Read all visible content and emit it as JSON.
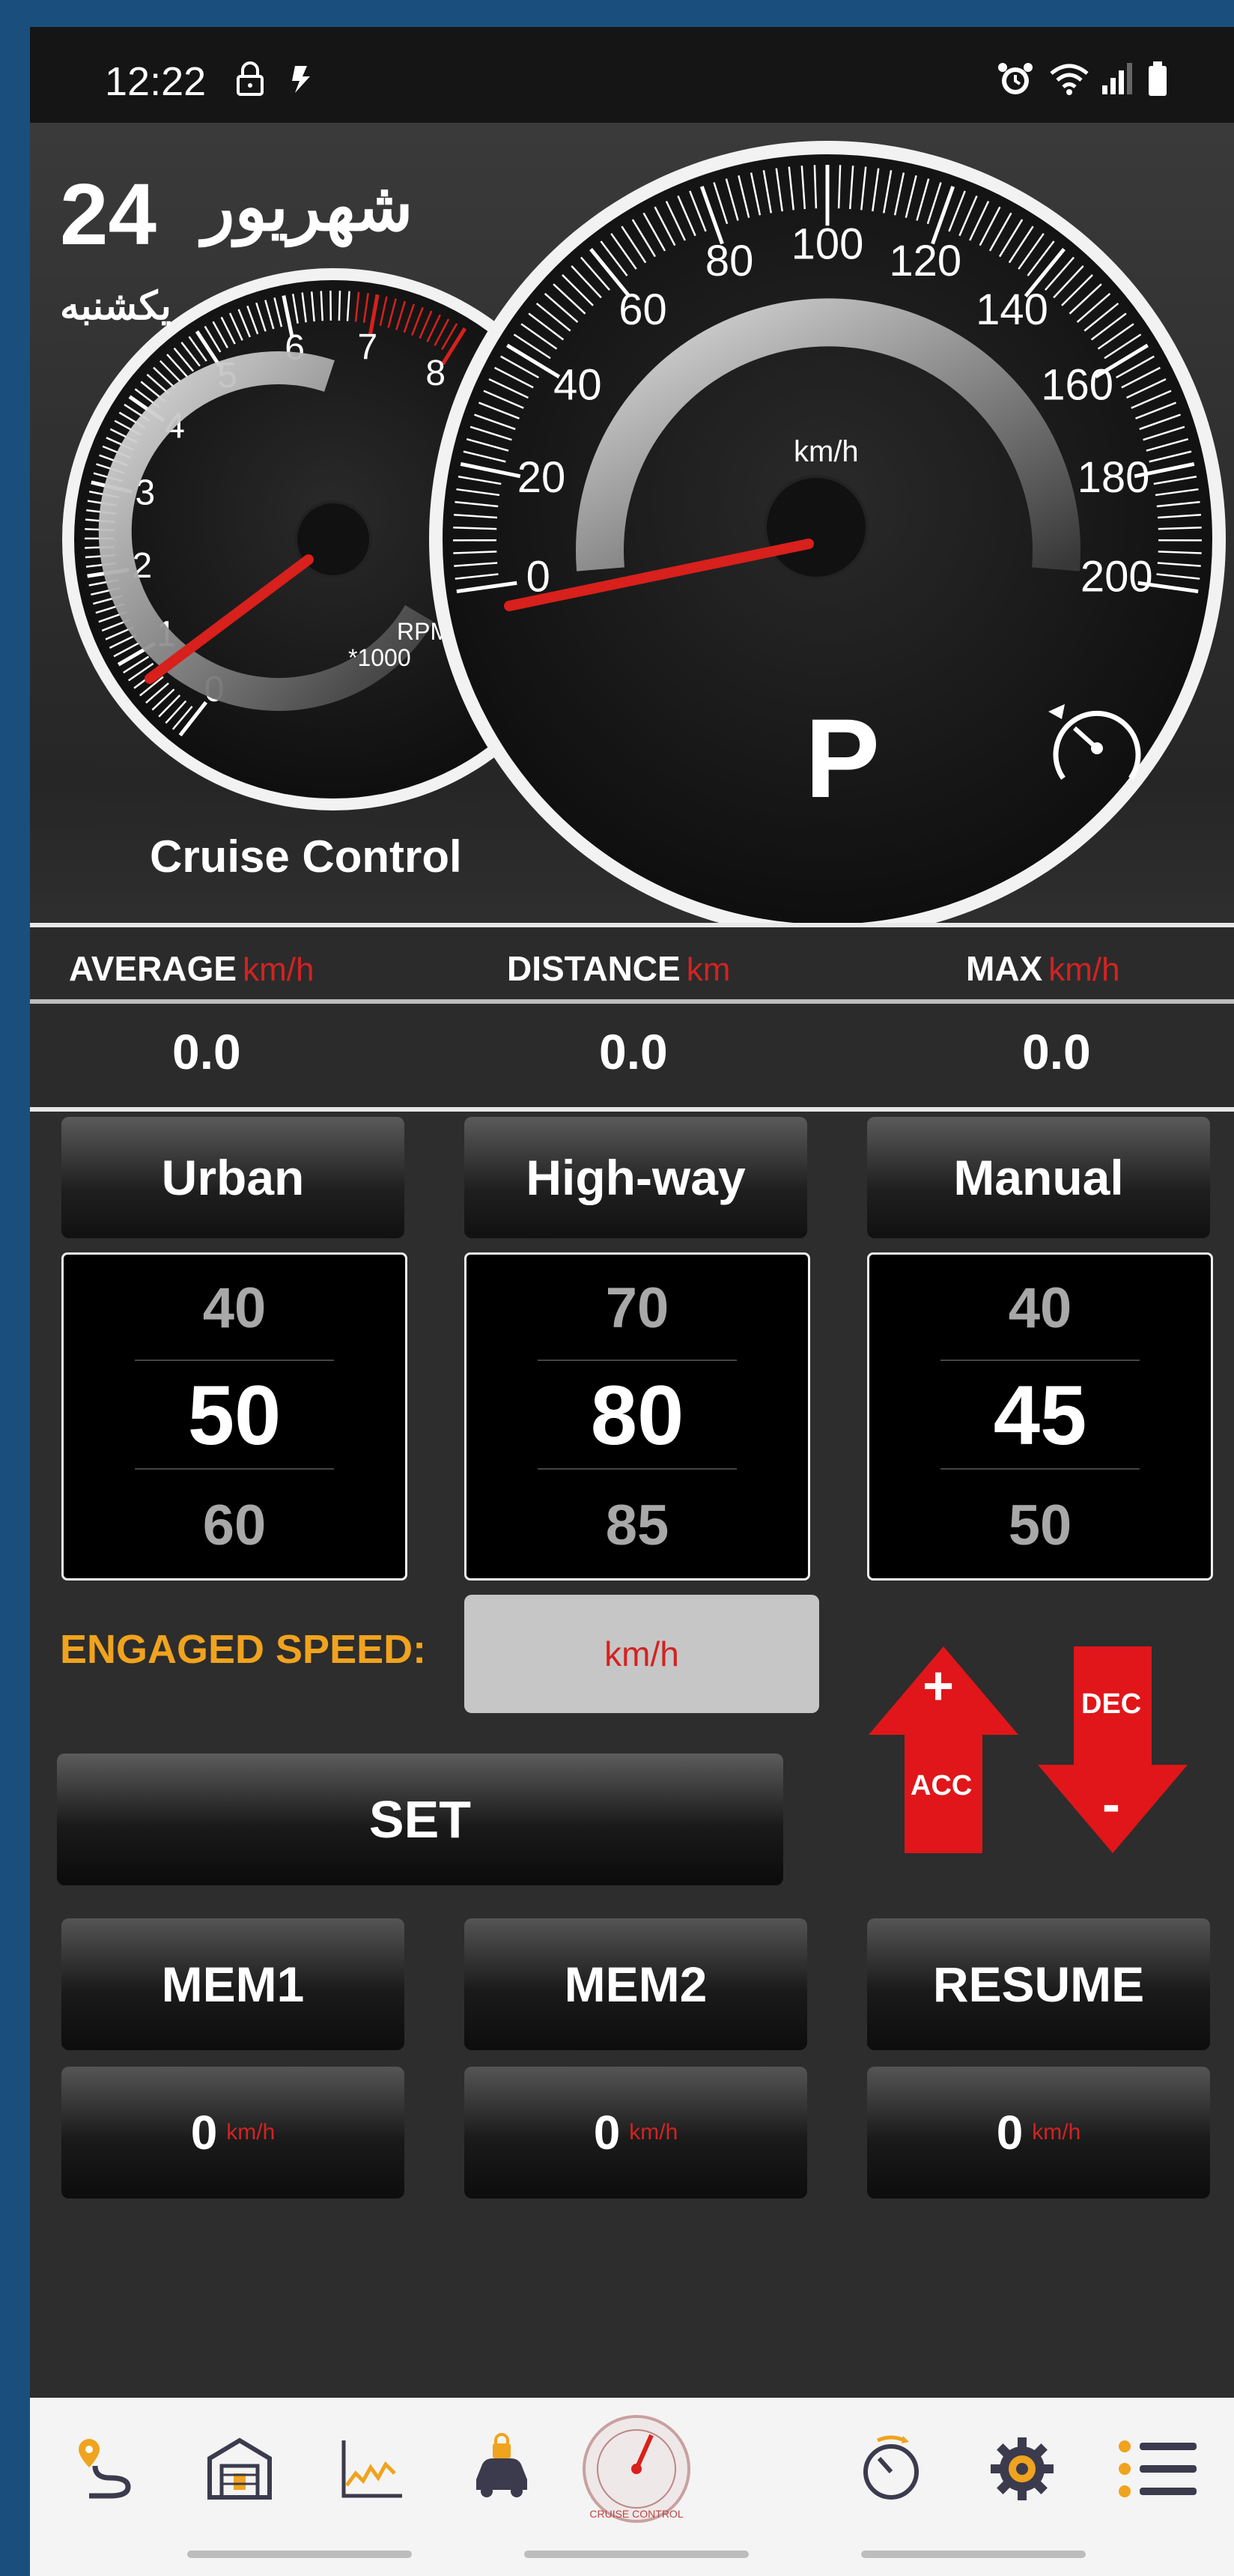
{
  "status_bar": {
    "time": "12:22",
    "icons": [
      "lock-icon",
      "notification-icon",
      "alarm-icon",
      "wifi-icon",
      "signal-icon",
      "battery-icon"
    ]
  },
  "date": {
    "day_number": "24",
    "month": "شهریور",
    "weekday": "یکشنبه"
  },
  "rpm_gauge": {
    "ticks": [
      "0",
      "1",
      "2",
      "3",
      "4",
      "5",
      "6",
      "7",
      "8"
    ],
    "unit_line1": "RPM",
    "unit_line2": "*1000",
    "value": 0
  },
  "speed_gauge": {
    "ticks": [
      "0",
      "20",
      "40",
      "60",
      "80",
      "100",
      "120",
      "140",
      "160",
      "180",
      "200"
    ],
    "unit": "km/h",
    "gear": "P",
    "value": 0
  },
  "title": "Cruise Control",
  "stats": {
    "average": {
      "label": "AVERAGE",
      "unit": "km/h",
      "value": "0.0"
    },
    "distance": {
      "label": "DISTANCE",
      "unit": "km",
      "value": "0.0"
    },
    "max": {
      "label": "MAX",
      "unit": "km/h",
      "value": "0.0"
    }
  },
  "modes": [
    {
      "label": "Urban",
      "above": "40",
      "selected": "50",
      "below": "60"
    },
    {
      "label": "High-way",
      "above": "70",
      "selected": "80",
      "below": "85"
    },
    {
      "label": "Manual",
      "above": "40",
      "selected": "45",
      "below": "50"
    }
  ],
  "engaged": {
    "label": "ENGAGED SPEED:",
    "unit": "km/h"
  },
  "set_label": "SET",
  "acc": {
    "label": "ACC",
    "sign": "+"
  },
  "dec": {
    "label": "DEC",
    "sign": "-"
  },
  "memory": [
    {
      "label": "MEM1",
      "value": "0",
      "unit": "km/h"
    },
    {
      "label": "MEM2",
      "value": "0",
      "unit": "km/h"
    },
    {
      "label": "RESUME",
      "value": "0",
      "unit": "km/h"
    }
  ],
  "bottom_nav": [
    "route-icon",
    "garage-icon",
    "chart-icon",
    "car-lock-icon",
    "cruise-control-icon",
    "speedometer-icon",
    "settings-icon",
    "menu-icon"
  ],
  "bottom_nav_cruise_text": "CRUISE CONTROL",
  "colors": {
    "accent_red": "#d32222",
    "engaged_orange": "#f0a31e"
  }
}
